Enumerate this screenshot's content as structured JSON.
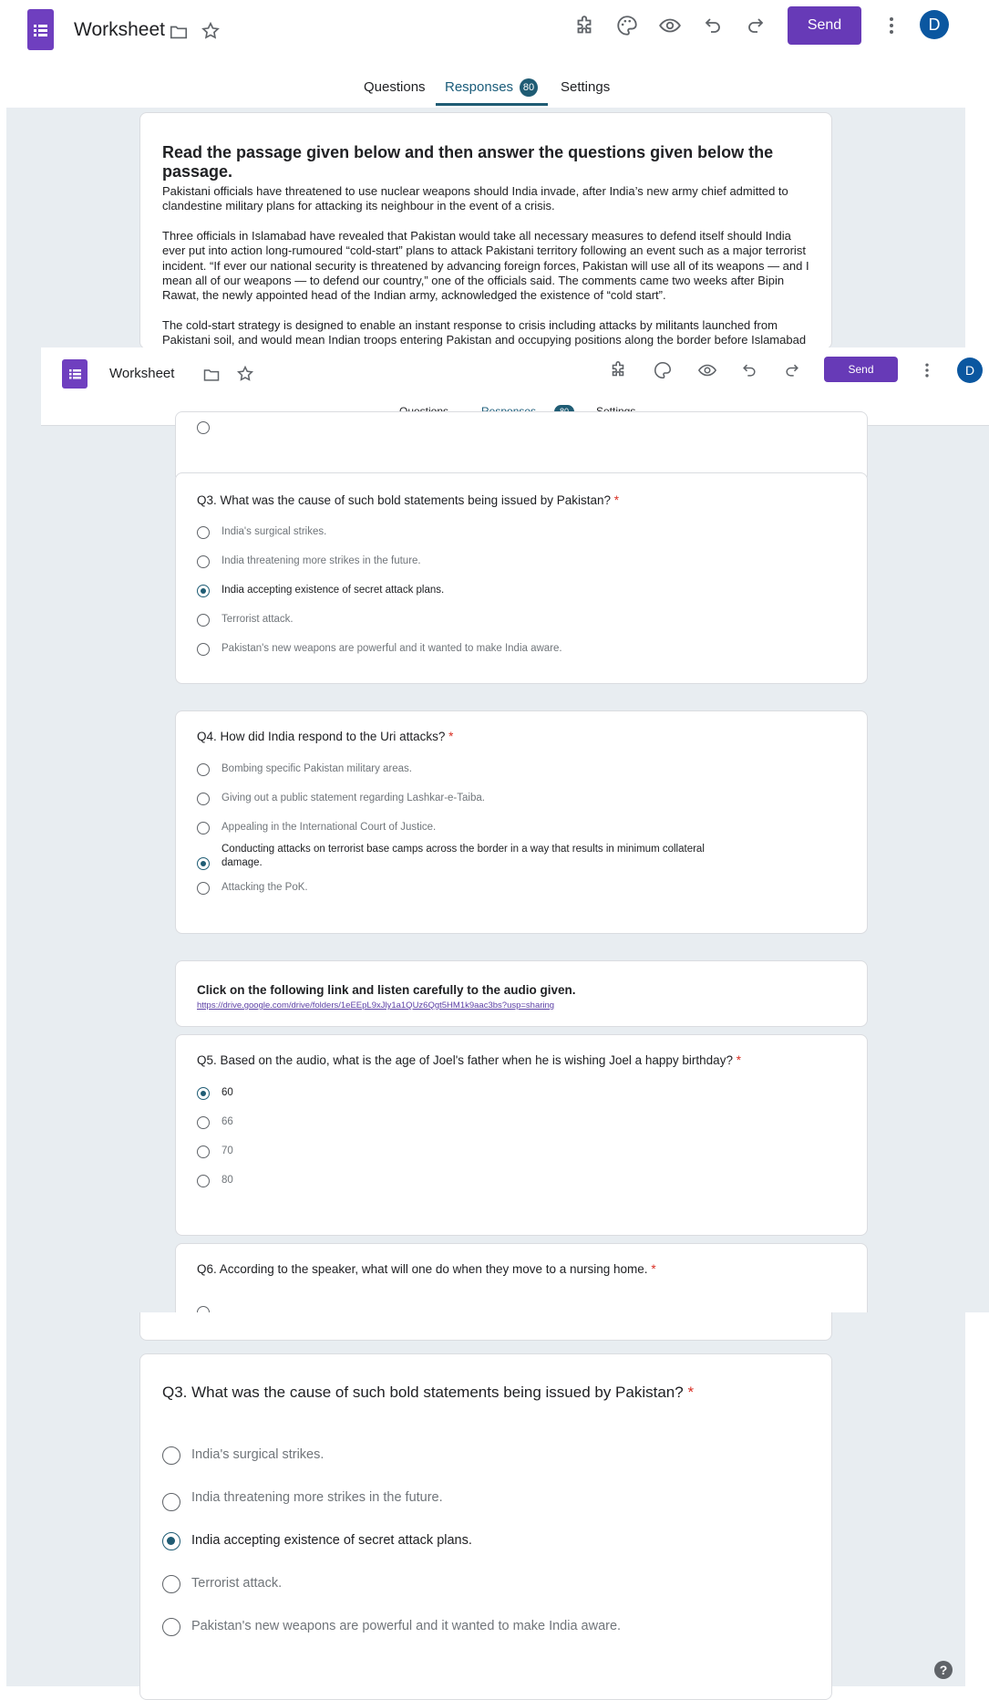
{
  "header": {
    "logo_icon": "forms-list-icon",
    "title": "Worksheet",
    "send_label": "Send",
    "avatar_letter": "D",
    "tabs": {
      "questions": "Questions",
      "responses": "Responses",
      "settings": "Settings"
    },
    "responses_count": "80",
    "accent": "#673ab7",
    "active_tab_color": "#1f5c74"
  },
  "passage": {
    "heading": "Read the passage given below and then answer the questions given below the passage.",
    "para1": "Pakistani officials have threatened to use nuclear weapons should India invade, after India’s new army chief admitted to clandestine military plans for attacking its neighbour in the event of a crisis.",
    "para2": "Three officials in Islamabad have revealed that Pakistan would take all necessary measures to defend itself should India ever put into action long-rumoured “cold-start” plans to attack Pakistani territory following an event such as a major terrorist incident. “If ever our national security is threatened by advancing foreign forces, Pakistan will use all of its weapons — and I mean all of our weapons — to defend our country,” one of the officials said. The comments came two weeks after Bipin Rawat, the newly appointed head of the Indian army, acknowledged the existence of “cold start”.",
    "para3": "The cold-start strategy is designed to enable an instant response to crisis including attacks by militants launched from Pakistani soil, and would mean Indian troops entering Pakistan and occupying positions along the border before Islamabad"
  },
  "q3": {
    "title": "Q3. What was the cause of such bold statements being issued by Pakistan?",
    "required": "*",
    "options": [
      "India's surgical strikes.",
      "India threatening more strikes in the future.",
      "India accepting existence of secret attack plans.",
      "Terrorist attack.",
      "Pakistan's new weapons are powerful and it wanted to make India aware."
    ],
    "selected_index": 2
  },
  "q4": {
    "title": "Q4. How did India respond to the Uri attacks?",
    "required": "*",
    "options": [
      "Bombing specific Pakistan military areas.",
      "Giving out a public statement regarding Lashkar-e-Taiba.",
      "Appealing in the International Court of Justice.",
      "Conducting attacks on terrorist base camps across the border in a way that results in minimum collateral",
      "Attacking the PoK."
    ],
    "option4_line2": "damage.",
    "selected_index": 3
  },
  "audio": {
    "title": "Click on the following link and listen carefully to the audio given.",
    "link": "https://drive.google.com/drive/folders/1eEEpL9xJly1a1QUz6Qgt5HM1k9aac3bs?usp=sharing"
  },
  "q5": {
    "title": "Q5. Based on the audio, what is the age of Joel's father when he is wishing Joel a happy birthday?",
    "required": "*",
    "options": [
      "60",
      "66",
      "70",
      "80"
    ],
    "selected_index": 0
  },
  "q6": {
    "title": "Q6. According to the speaker, what will one do when they move to a nursing home.",
    "required": "*"
  },
  "help_icon": "help-icon"
}
